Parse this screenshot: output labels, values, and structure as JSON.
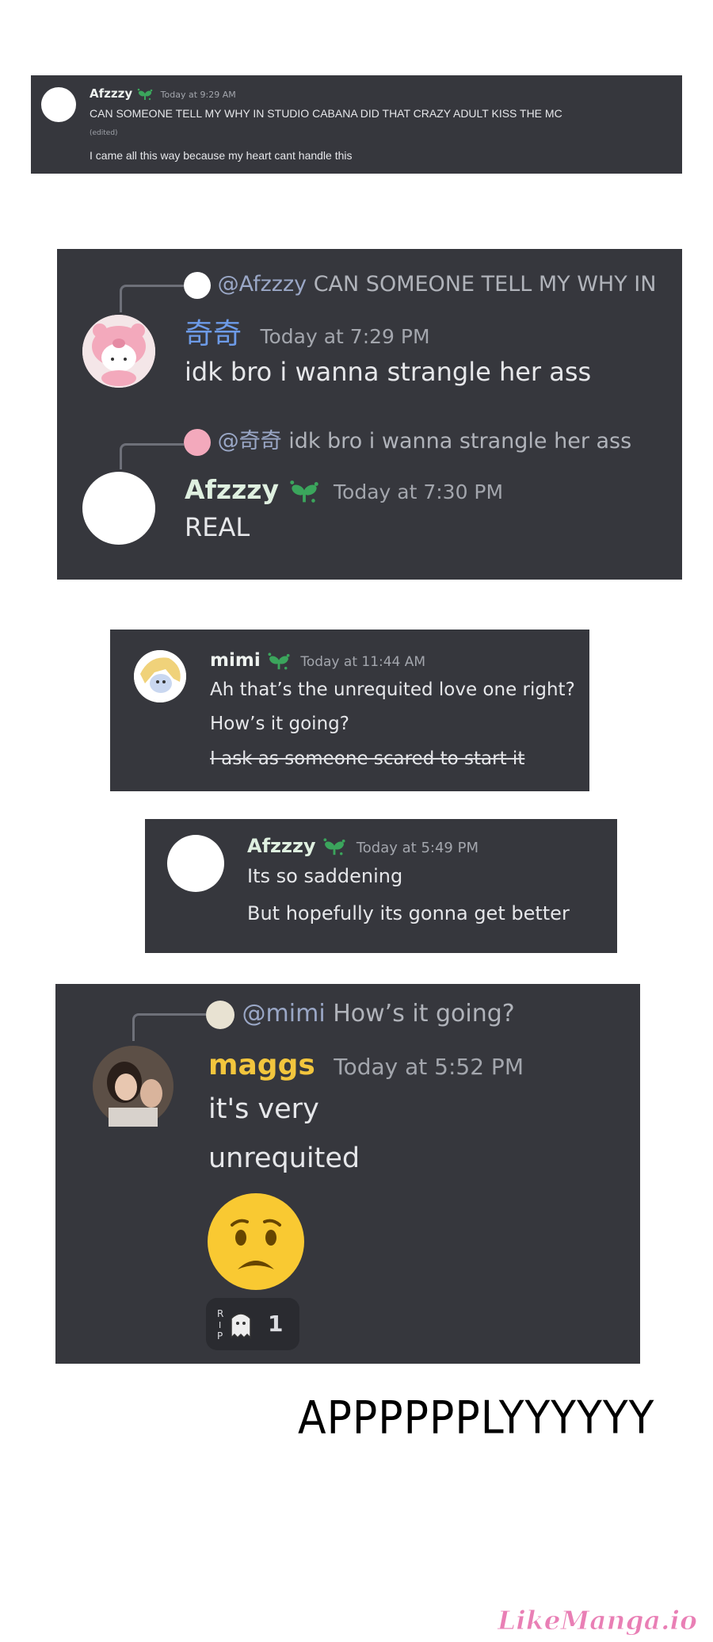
{
  "panel1": {
    "username": "Afzzzy",
    "timestamp": "Today at 9:29 AM",
    "line1": "CAN SOMEONE TELL MY WHY IN STUDIO CABANA DID THAT CRAZY ADULT KISS THE MC",
    "edited": "(edited)",
    "line2": "I came all this way because my heart cant handle this"
  },
  "panel2": {
    "reply1": {
      "mention": "@Afzzzy",
      "text": "CAN SOMEONE TELL MY WHY IN"
    },
    "msg1": {
      "username": "奇奇",
      "timestamp": "Today at 7:29 PM",
      "text": "idk bro i wanna strangle her ass"
    },
    "reply2": {
      "mention": "@奇奇",
      "text": "idk bro i wanna strangle her ass"
    },
    "msg2": {
      "username": "Afzzzy",
      "timestamp": "Today at 7:30 PM",
      "text": "REAL"
    }
  },
  "panel3": {
    "username": "mimi",
    "timestamp": "Today at 11:44 AM",
    "line1": "Ah that’s the unrequited love one right?",
    "line2": "How’s it going?",
    "line3": "I ask as someone scared to start it"
  },
  "panel4": {
    "username": "Afzzzy",
    "timestamp": "Today at 5:49 PM",
    "line1": "Its so saddening",
    "line2": "But hopefully its gonna get better"
  },
  "panel5": {
    "reply": {
      "mention": "@mimi",
      "text": "How’s it going?"
    },
    "username": "maggs",
    "timestamp": "Today at 5:52 PM",
    "line1": "it's very",
    "line2": "unrequited",
    "emoji": "worried-face",
    "reaction_count": "1"
  },
  "caption": "APPPPPPLYYYYYY",
  "watermark": "LikeManga.io",
  "colors": {
    "panel_bg": "#36373d",
    "name_green": "#dff0e0",
    "name_blue": "#6d9be8",
    "name_yellow": "#f2c53d",
    "sprout": "#3ba55c"
  }
}
